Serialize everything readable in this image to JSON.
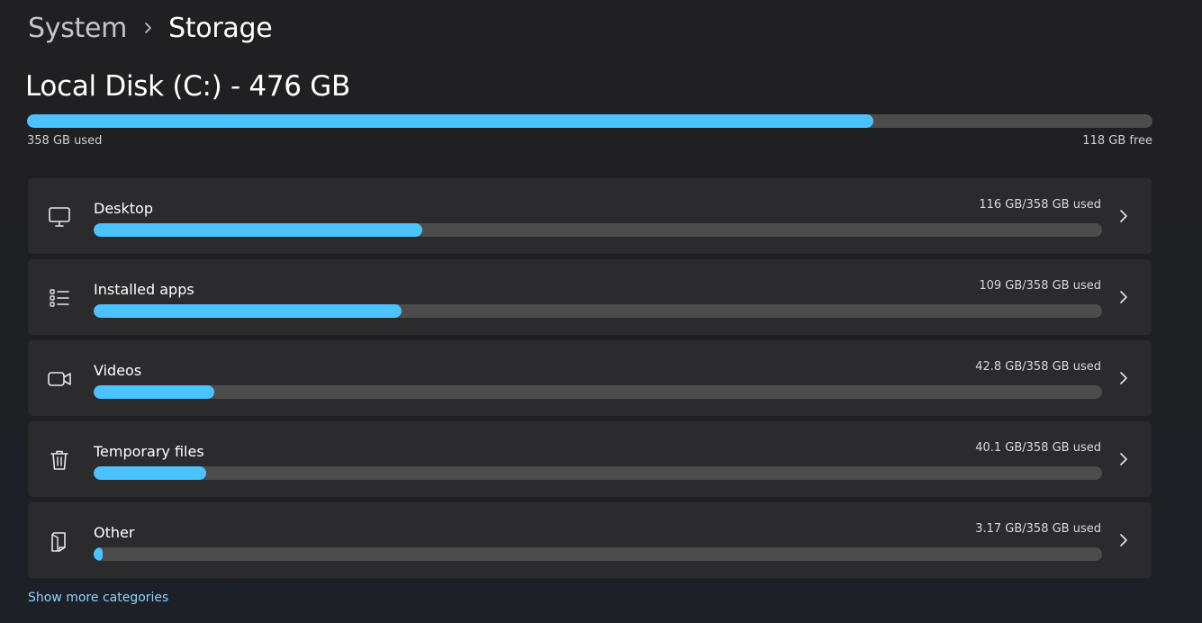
{
  "breadcrumb": {
    "parent": "System",
    "current": "Storage"
  },
  "disk": {
    "title": "Local Disk (C:) - 476 GB",
    "used_label": "358 GB used",
    "free_label": "118 GB free",
    "used_fraction": 0.752
  },
  "categories": [
    {
      "icon": "monitor-icon",
      "label": "Desktop",
      "usage": "116 GB/358 GB used",
      "fraction": 0.326
    },
    {
      "icon": "app-list-icon",
      "label": "Installed apps",
      "usage": "109 GB/358 GB used",
      "fraction": 0.305
    },
    {
      "icon": "video-camera-icon",
      "label": "Videos",
      "usage": "42.8 GB/358 GB used",
      "fraction": 0.12
    },
    {
      "icon": "trash-icon",
      "label": "Temporary files",
      "usage": "40.1 GB/358 GB used",
      "fraction": 0.112
    },
    {
      "icon": "document-icon",
      "label": "Other",
      "usage": "3.17 GB/358 GB used",
      "fraction": 0.009
    }
  ],
  "show_more_label": "Show more categories",
  "colors": {
    "accent": "#4cc2ff",
    "track": "#4c4c4c",
    "card": "#2b2b2e",
    "link": "#8ad4ff"
  }
}
